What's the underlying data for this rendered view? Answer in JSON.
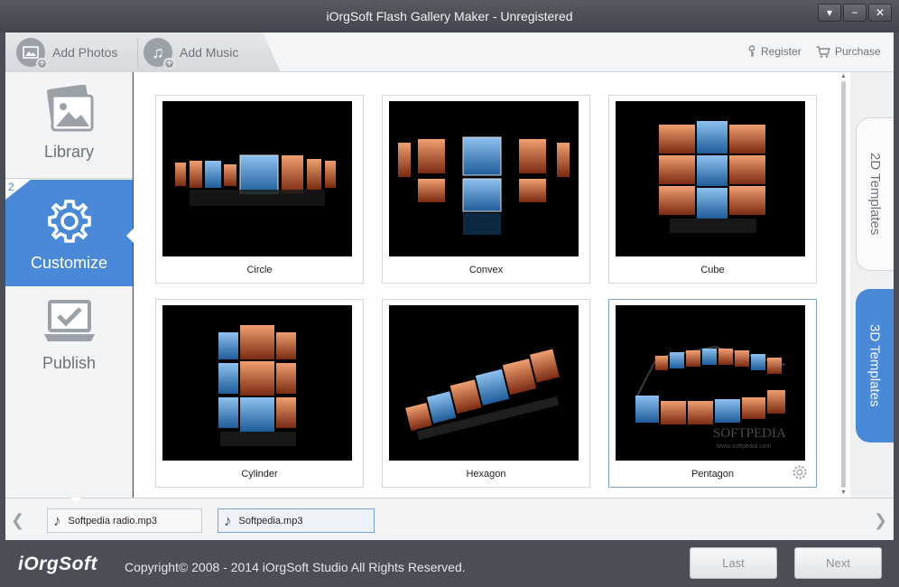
{
  "window": {
    "title": "iOrgSoft Flash Gallery Maker - Unregistered"
  },
  "toolbar": {
    "add_photos": "Add Photos",
    "add_music": "Add Music",
    "register": "Register",
    "purchase": "Purchase"
  },
  "sidebar": {
    "items": [
      {
        "label": "Library",
        "icon": "photos-icon"
      },
      {
        "label": "Customize",
        "icon": "gear-icon",
        "step": "2",
        "active": true
      },
      {
        "label": "Publish",
        "icon": "laptop-check-icon"
      }
    ]
  },
  "templates": [
    {
      "label": "Circle"
    },
    {
      "label": "Convex"
    },
    {
      "label": "Cube"
    },
    {
      "label": "Cylinder"
    },
    {
      "label": "Hexagon"
    },
    {
      "label": "Pentagon",
      "selected": true
    }
  ],
  "tabs": {
    "t2d": "2D Templates",
    "t3d": "3D Templates",
    "active": "3D Templates"
  },
  "music": {
    "files": [
      {
        "name": "Softpedia radio.mp3"
      },
      {
        "name": "Softpedia.mp3",
        "selected": true
      }
    ]
  },
  "watermark": {
    "brand": "SOFTPEDIA",
    "url": "www.softpedia.com"
  },
  "footer": {
    "logo": "iOrgSoft",
    "copyright": "Copyright© 2008 - 2014 iOrgSoft Studio All Rights Reserved.",
    "last": "Last",
    "next": "Next"
  },
  "colors": {
    "accent": "#4a89d8",
    "chrome": "#4a4f57",
    "muted_text": "#6d737b"
  }
}
